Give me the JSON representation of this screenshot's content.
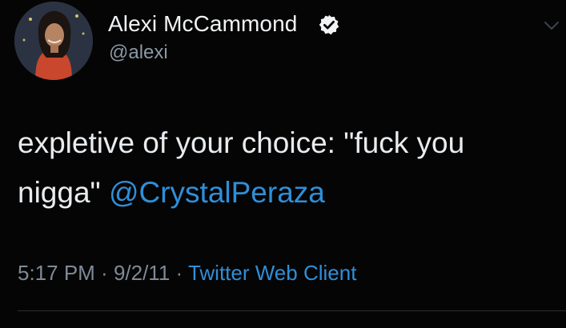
{
  "user": {
    "display_name": "Alexi McCammond",
    "handle": "@alexi",
    "verified": true
  },
  "tweet": {
    "text_before": "expletive of your choice: \"fuck you nigga\" ",
    "mention": "@CrystalPeraza"
  },
  "meta": {
    "time": "5:17 PM",
    "sep1": " · ",
    "date": "9/2/11",
    "sep2": " · ",
    "source": "Twitter Web Client"
  },
  "icons": {
    "verified": "verified-badge-icon",
    "menu": "chevron-down-icon"
  },
  "colors": {
    "background": "#050505",
    "text": "#e9ecef",
    "muted": "#7f8a96",
    "link": "#2f8fd8"
  }
}
